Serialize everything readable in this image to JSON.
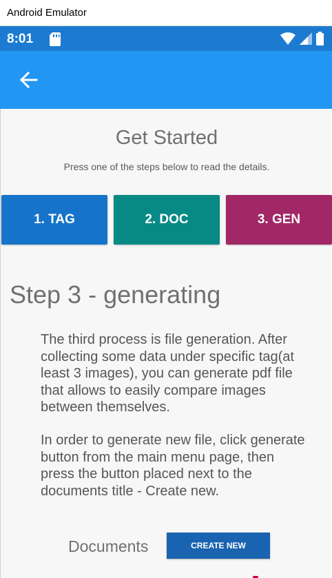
{
  "window": {
    "title": "Android Emulator"
  },
  "status_bar": {
    "time": "8:01",
    "icons": [
      "sd-card-icon",
      "wifi-icon",
      "signal-icon",
      "battery-icon"
    ]
  },
  "app_bar": {
    "back_icon": "arrow-left-icon"
  },
  "page": {
    "title": "Get Started",
    "subtitle": "Press one of the steps below to read the details."
  },
  "steps": [
    {
      "label": "1. TAG",
      "color": "#1574c9"
    },
    {
      "label": "2. DOC",
      "color": "#078a85"
    },
    {
      "label": "3. GEN",
      "color": "#a12766"
    }
  ],
  "section": {
    "title": "Step 3 - generating",
    "paragraph1": "The third process is file generation. After collecting some data under specific tag(at least 3 images), you can generate pdf file that allows to easily compare images between themselves.",
    "paragraph2": "In order to generate new file, click generate button from the main menu page, then press the button placed next to the documents title - Create new."
  },
  "documents": {
    "label": "Documents",
    "create_button": "CREATE NEW"
  },
  "colors": {
    "status_bar": "#1c7bd0",
    "app_bar": "#2196f3",
    "background": "#f7f7f7"
  }
}
